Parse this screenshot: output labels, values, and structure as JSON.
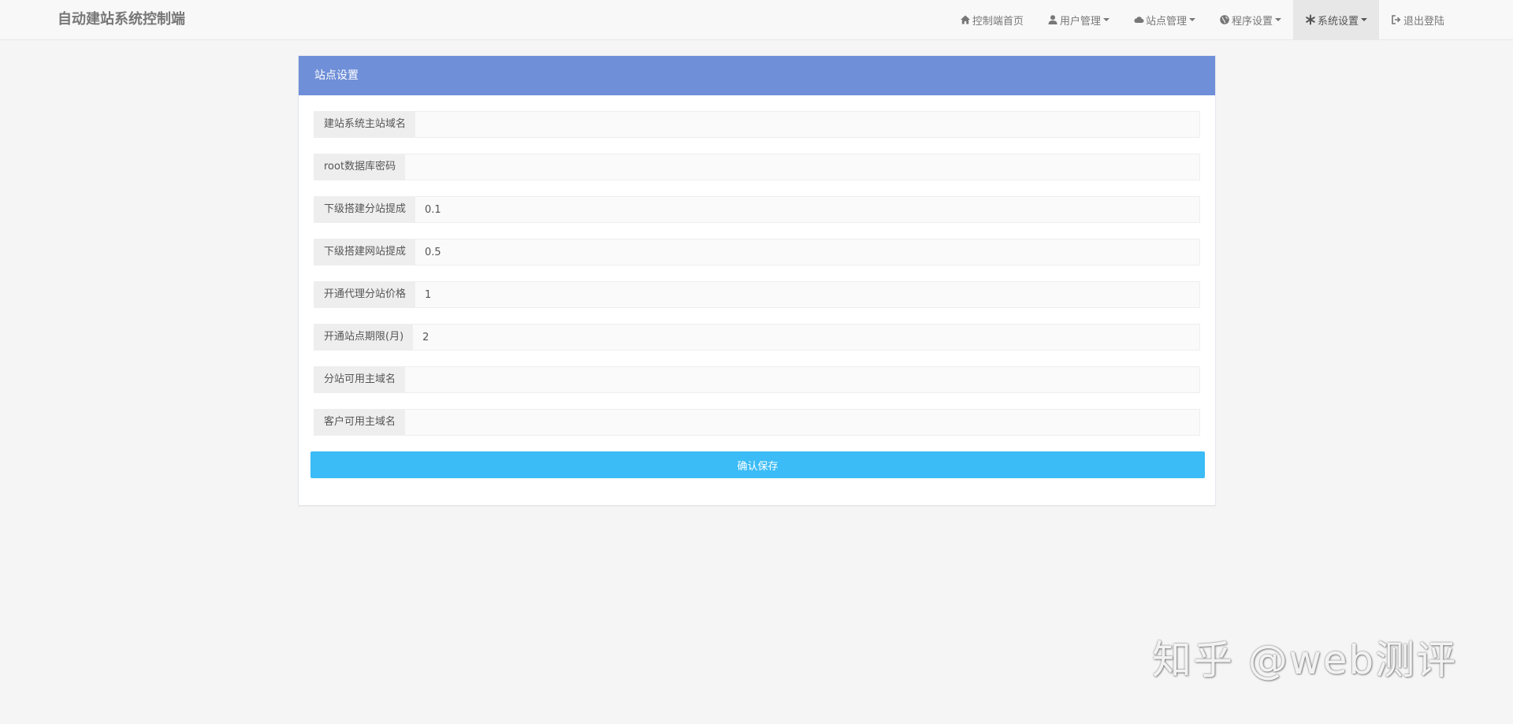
{
  "navbar": {
    "brand": "自动建站系统控制端",
    "items": [
      {
        "label": "控制端首页",
        "icon": "home-icon",
        "dropdown": false,
        "active": false
      },
      {
        "label": "用户管理",
        "icon": "user-icon",
        "dropdown": true,
        "active": false
      },
      {
        "label": "站点管理",
        "icon": "cloud-icon",
        "dropdown": true,
        "active": false
      },
      {
        "label": "程序设置",
        "icon": "globe-icon",
        "dropdown": true,
        "active": false
      },
      {
        "label": "系统设置",
        "icon": "asterisk-icon",
        "dropdown": true,
        "active": true
      },
      {
        "label": "退出登陆",
        "icon": "logout-icon",
        "dropdown": false,
        "active": false
      }
    ]
  },
  "panel": {
    "title": "站点设置",
    "fields": [
      {
        "label": "建站系统主站域名",
        "value": ""
      },
      {
        "label": "root数据库密码",
        "value": ""
      },
      {
        "label": "下级搭建分站提成",
        "value": "0.1"
      },
      {
        "label": "下级搭建网站提成",
        "value": "0.5"
      },
      {
        "label": "开通代理分站价格",
        "value": "1"
      },
      {
        "label": "开通站点期限(月)",
        "value": "2"
      },
      {
        "label": "分站可用主域名",
        "value": ""
      },
      {
        "label": "客户可用主域名",
        "value": ""
      }
    ],
    "save_label": "确认保存"
  },
  "watermark": "知乎 @web测评",
  "colors": {
    "panel_heading": "#6f8fd8",
    "save_button": "#3bbcf6",
    "navbar_bg": "#f8f8f8"
  }
}
